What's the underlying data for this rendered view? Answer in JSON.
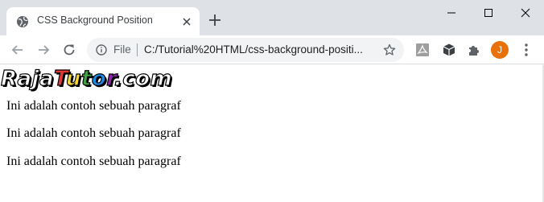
{
  "browser": {
    "tab": {
      "title": "CSS Background Position"
    },
    "address_bar": {
      "scheme_label": "File",
      "url": "C:/Tutorial%20HTML/css-background-positi..."
    },
    "profile_initial": "J",
    "icons": {
      "favicon": "globe-icon",
      "tab_close": "close-icon",
      "new_tab": "plus-icon",
      "minimize": "minimize-icon",
      "maximize": "maximize-icon",
      "window_close": "close-icon",
      "back": "arrow-left-icon",
      "forward": "arrow-right-icon",
      "reload": "reload-icon",
      "site_info": "info-icon",
      "bookmark": "star-icon",
      "ext_pdf": "pdf-icon",
      "ext_cube": "cube-icon",
      "extensions": "puzzle-icon",
      "menu": "kebab-menu-icon"
    },
    "colors": {
      "tabstrip": "#dee1e6",
      "omnibox": "#f1f3f4",
      "avatar": "#e8710a"
    }
  },
  "page": {
    "logo": {
      "part1": "Raja",
      "part2": "Tutor",
      "part3": ".com"
    },
    "paragraphs": [
      "Ini adalah contoh sebuah paragraf",
      "Ini adalah contoh sebuah paragraf",
      "Ini adalah contoh sebuah paragraf"
    ]
  }
}
